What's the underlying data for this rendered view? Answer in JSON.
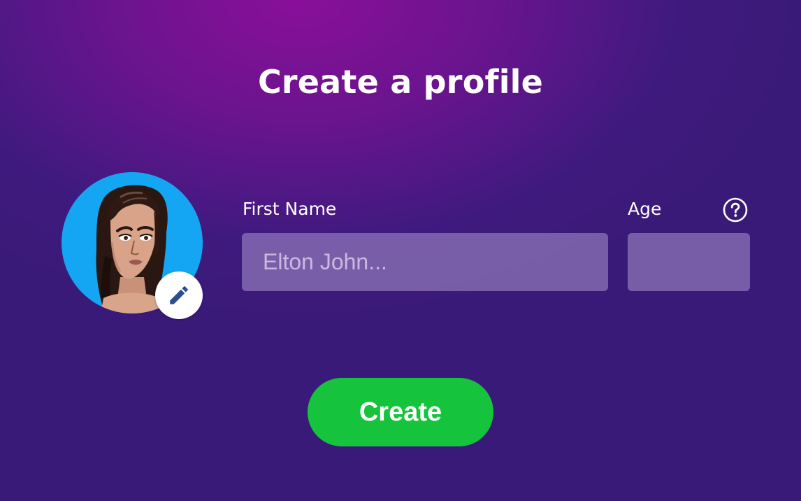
{
  "title": "Create a profile",
  "avatar": {
    "icon": "avatar-portrait-illustration",
    "background_color": "#14a6f2",
    "edit_icon": "pencil-icon"
  },
  "form": {
    "first_name": {
      "label": "First Name",
      "placeholder": "Elton John...",
      "value": ""
    },
    "age": {
      "label": "Age",
      "value": "",
      "help_icon": "question-circle-icon"
    }
  },
  "actions": {
    "create_label": "Create",
    "create_color": "#15c43c"
  },
  "colors": {
    "background_top": "#8a0f9a",
    "background_bottom": "#3a1a78",
    "input_fill": "#9a84c4"
  }
}
